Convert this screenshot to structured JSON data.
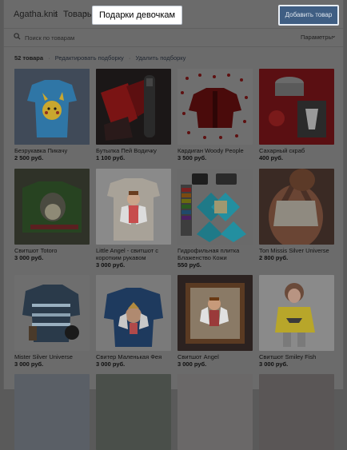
{
  "header": {
    "crumbs": [
      "Agatha.knit",
      "Товары"
    ],
    "active": "Подарки девочкам",
    "add_button": "Добавить товар"
  },
  "search": {
    "placeholder": "Поиск по товарам",
    "params_label": "Параметры"
  },
  "meta": {
    "count": "52 товара",
    "edit": "Редактировать подборку",
    "delete": "Удалить подборку"
  },
  "products": [
    {
      "title": "Безрукавка Пикачу",
      "price": "2 500 руб."
    },
    {
      "title": "Бутылка Пей Водичку",
      "price": "1 100 руб."
    },
    {
      "title": "Кардиган Woody People",
      "price": "3 500 руб."
    },
    {
      "title": "Сахарный скраб",
      "price": "400 руб."
    },
    {
      "title": "Свитшот Totoro",
      "price": "3 000 руб."
    },
    {
      "title": "Little Angel - свитшот с коротким рукавом",
      "price": "3 000 руб."
    },
    {
      "title": "Гидрофильная плитка Блаженство Кожи",
      "price": "550 руб."
    },
    {
      "title": "Топ Missis Silver Universe",
      "price": "2 800 руб."
    },
    {
      "title": "Mister Silver Universe",
      "price": "3 000 руб."
    },
    {
      "title": "Свитер Маленькая Фея",
      "price": "3 000 руб."
    },
    {
      "title": "Свитшот Angel",
      "price": "3 000 руб."
    },
    {
      "title": "Свитшот Smiley Fish",
      "price": "3 000 руб."
    }
  ],
  "colors": {
    "overlay_bg": "#6b6b6b",
    "button_bg": "#3f5e83",
    "link": "#1e2530"
  }
}
